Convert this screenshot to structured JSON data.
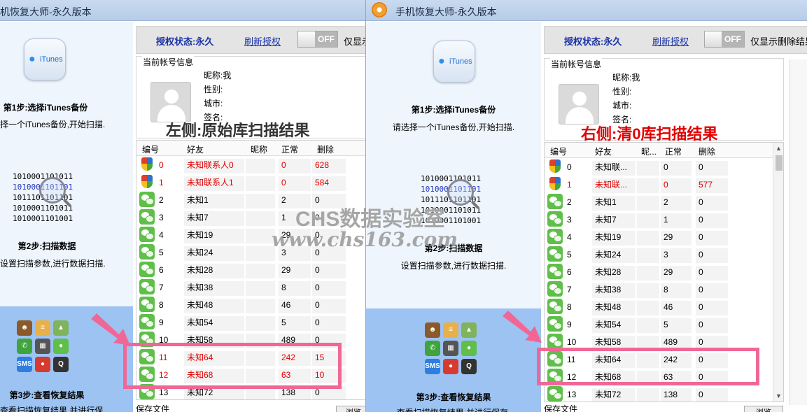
{
  "app_title": "手机恢复大师-永久版本",
  "left_title_visible": "机恢复大师-永久版本",
  "itunes_label": "iTunes",
  "steps": {
    "step1_title": "第1步:选择iTunes备份",
    "step1_desc": "请选择一个iTunes备份,开始扫描.",
    "step1_desc_left": "择一个iTunes备份,开始扫描.",
    "step2_title": "第2步:扫描数据",
    "step2_desc": "设置扫描参数,进行数据扫描.",
    "step3_title": "第3步:查看恢复结果",
    "step3_desc": "查看扫描恢复结果,并进行保存."
  },
  "binary_lines": [
    "1010001101011",
    "1010001101101",
    "1011101101101",
    "1010001101011",
    "1010001101001"
  ],
  "toolbar": {
    "auth_status": "授权状态:永久",
    "refresh_auth": "刷新授权",
    "toggle_label": "OFF",
    "only_show": "仅显示删除结果",
    "only_show_left": "仅显示"
  },
  "account": {
    "header": "当前帐号信息",
    "nickname": "昵称:我",
    "gender": "性别:",
    "city": "城市:",
    "signature": "签名:"
  },
  "captions": {
    "left": "左侧:原始库扫描结果",
    "right": "右侧:清0库扫描结果",
    "left_color": "#333333",
    "right_color": "#e00000"
  },
  "columns": {
    "id": "编号",
    "friend": "好友",
    "nickname": "昵称",
    "nickname_short": "昵...",
    "normal": "正常",
    "deleted": "删除"
  },
  "left_rows": [
    {
      "id": "0",
      "friend": "未知联系人0",
      "normal": "0",
      "deleted": "628",
      "icon": "shield-icon",
      "red": true
    },
    {
      "id": "1",
      "friend": "未知联系人1",
      "normal": "0",
      "deleted": "584",
      "icon": "shield-icon",
      "red": true
    },
    {
      "id": "2",
      "friend": "未知1",
      "normal": "2",
      "deleted": "0",
      "icon": "wechat-icon",
      "red": false
    },
    {
      "id": "3",
      "friend": "未知7",
      "normal": "1",
      "deleted": "0",
      "icon": "wechat-icon",
      "red": false
    },
    {
      "id": "4",
      "friend": "未知19",
      "normal": "29",
      "deleted": "0",
      "icon": "wechat-icon",
      "red": false
    },
    {
      "id": "5",
      "friend": "未知24",
      "normal": "3",
      "deleted": "0",
      "icon": "wechat-icon",
      "red": false
    },
    {
      "id": "6",
      "friend": "未知28",
      "normal": "29",
      "deleted": "0",
      "icon": "wechat-icon",
      "red": false
    },
    {
      "id": "7",
      "friend": "未知38",
      "normal": "8",
      "deleted": "0",
      "icon": "wechat-icon",
      "red": false
    },
    {
      "id": "8",
      "friend": "未知48",
      "normal": "46",
      "deleted": "0",
      "icon": "wechat-icon",
      "red": false
    },
    {
      "id": "9",
      "friend": "未知54",
      "normal": "5",
      "deleted": "0",
      "icon": "wechat-icon",
      "red": false
    },
    {
      "id": "10",
      "friend": "未知58",
      "normal": "489",
      "deleted": "0",
      "icon": "wechat-icon",
      "red": false
    },
    {
      "id": "11",
      "friend": "未知64",
      "normal": "242",
      "deleted": "15",
      "icon": "wechat-icon",
      "red": true
    },
    {
      "id": "12",
      "friend": "未知68",
      "normal": "63",
      "deleted": "10",
      "icon": "wechat-icon",
      "red": true
    },
    {
      "id": "13",
      "friend": "未知72",
      "normal": "138",
      "deleted": "0",
      "icon": "wechat-icon",
      "red": false
    }
  ],
  "right_rows": [
    {
      "id": "0",
      "friend": "未知联...",
      "normal": "0",
      "deleted": "0",
      "icon": "shield-icon",
      "red": false
    },
    {
      "id": "1",
      "friend": "未知联...",
      "normal": "0",
      "deleted": "577",
      "icon": "shield-icon",
      "red": true
    },
    {
      "id": "2",
      "friend": "未知1",
      "normal": "2",
      "deleted": "0",
      "icon": "wechat-icon",
      "red": false
    },
    {
      "id": "3",
      "friend": "未知7",
      "normal": "1",
      "deleted": "0",
      "icon": "wechat-icon",
      "red": false
    },
    {
      "id": "4",
      "friend": "未知19",
      "normal": "29",
      "deleted": "0",
      "icon": "wechat-icon",
      "red": false
    },
    {
      "id": "5",
      "friend": "未知24",
      "normal": "3",
      "deleted": "0",
      "icon": "wechat-icon",
      "red": false
    },
    {
      "id": "6",
      "friend": "未知28",
      "normal": "29",
      "deleted": "0",
      "icon": "wechat-icon",
      "red": false
    },
    {
      "id": "7",
      "friend": "未知38",
      "normal": "8",
      "deleted": "0",
      "icon": "wechat-icon",
      "red": false
    },
    {
      "id": "8",
      "friend": "未知48",
      "normal": "46",
      "deleted": "0",
      "icon": "wechat-icon",
      "red": false
    },
    {
      "id": "9",
      "friend": "未知54",
      "normal": "5",
      "deleted": "0",
      "icon": "wechat-icon",
      "red": false
    },
    {
      "id": "10",
      "friend": "未知58",
      "normal": "489",
      "deleted": "0",
      "icon": "wechat-icon",
      "red": false
    },
    {
      "id": "11",
      "friend": "未知64",
      "normal": "242",
      "deleted": "0",
      "icon": "wechat-icon",
      "red": false
    },
    {
      "id": "12",
      "friend": "未知68",
      "normal": "63",
      "deleted": "0",
      "icon": "wechat-icon",
      "red": false
    },
    {
      "id": "13",
      "friend": "未知72",
      "normal": "138",
      "deleted": "0",
      "icon": "wechat-icon",
      "red": false
    }
  ],
  "bottom": {
    "export_label": "保存文件",
    "button_label": "浏览"
  },
  "watermark": {
    "line1": "CHS数据实验室",
    "line2": "www.chs163.com"
  },
  "colors": {
    "highlight": "#f06796",
    "red_text": "#e00000",
    "link_blue": "#1a32a8",
    "titlebar": "#c9daf0",
    "step_panel": "#9dc3f2"
  }
}
